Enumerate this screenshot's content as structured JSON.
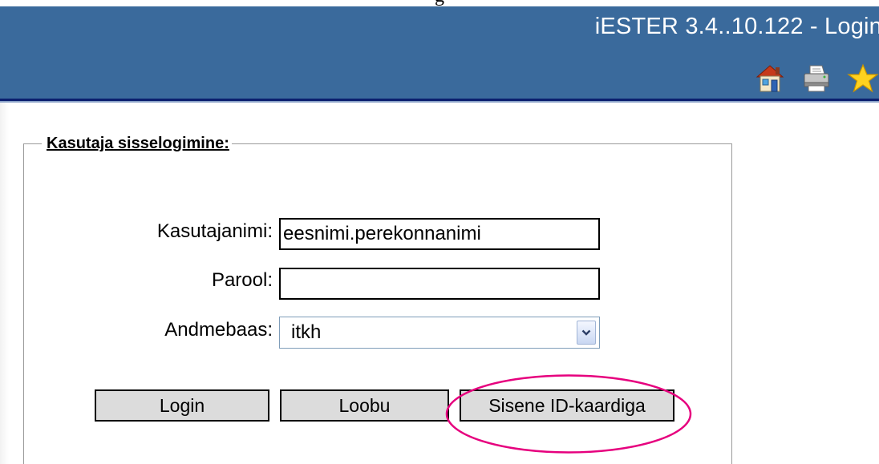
{
  "header": {
    "title": "iESTER 3.4..10.122 - Login",
    "top_clip_text": "g",
    "bg_color": "#3a6a9c",
    "icons": [
      "home-icon",
      "print-icon",
      "star-icon"
    ]
  },
  "login": {
    "legend": "Kasutaja sisselogimine:",
    "username_label": "Kasutajanimi:",
    "username_value": "eesnimi.perekonnanimi",
    "password_label": "Parool:",
    "password_value": "",
    "database_label": "Andmebaas:",
    "database_value": "itkh",
    "buttons": {
      "login": "Login",
      "cancel": "Loobu",
      "id_card": "Sisene ID-kaardiga"
    }
  },
  "annotation": {
    "highlight_color": "#e6007e",
    "highlighted": "id-card-login-button"
  }
}
